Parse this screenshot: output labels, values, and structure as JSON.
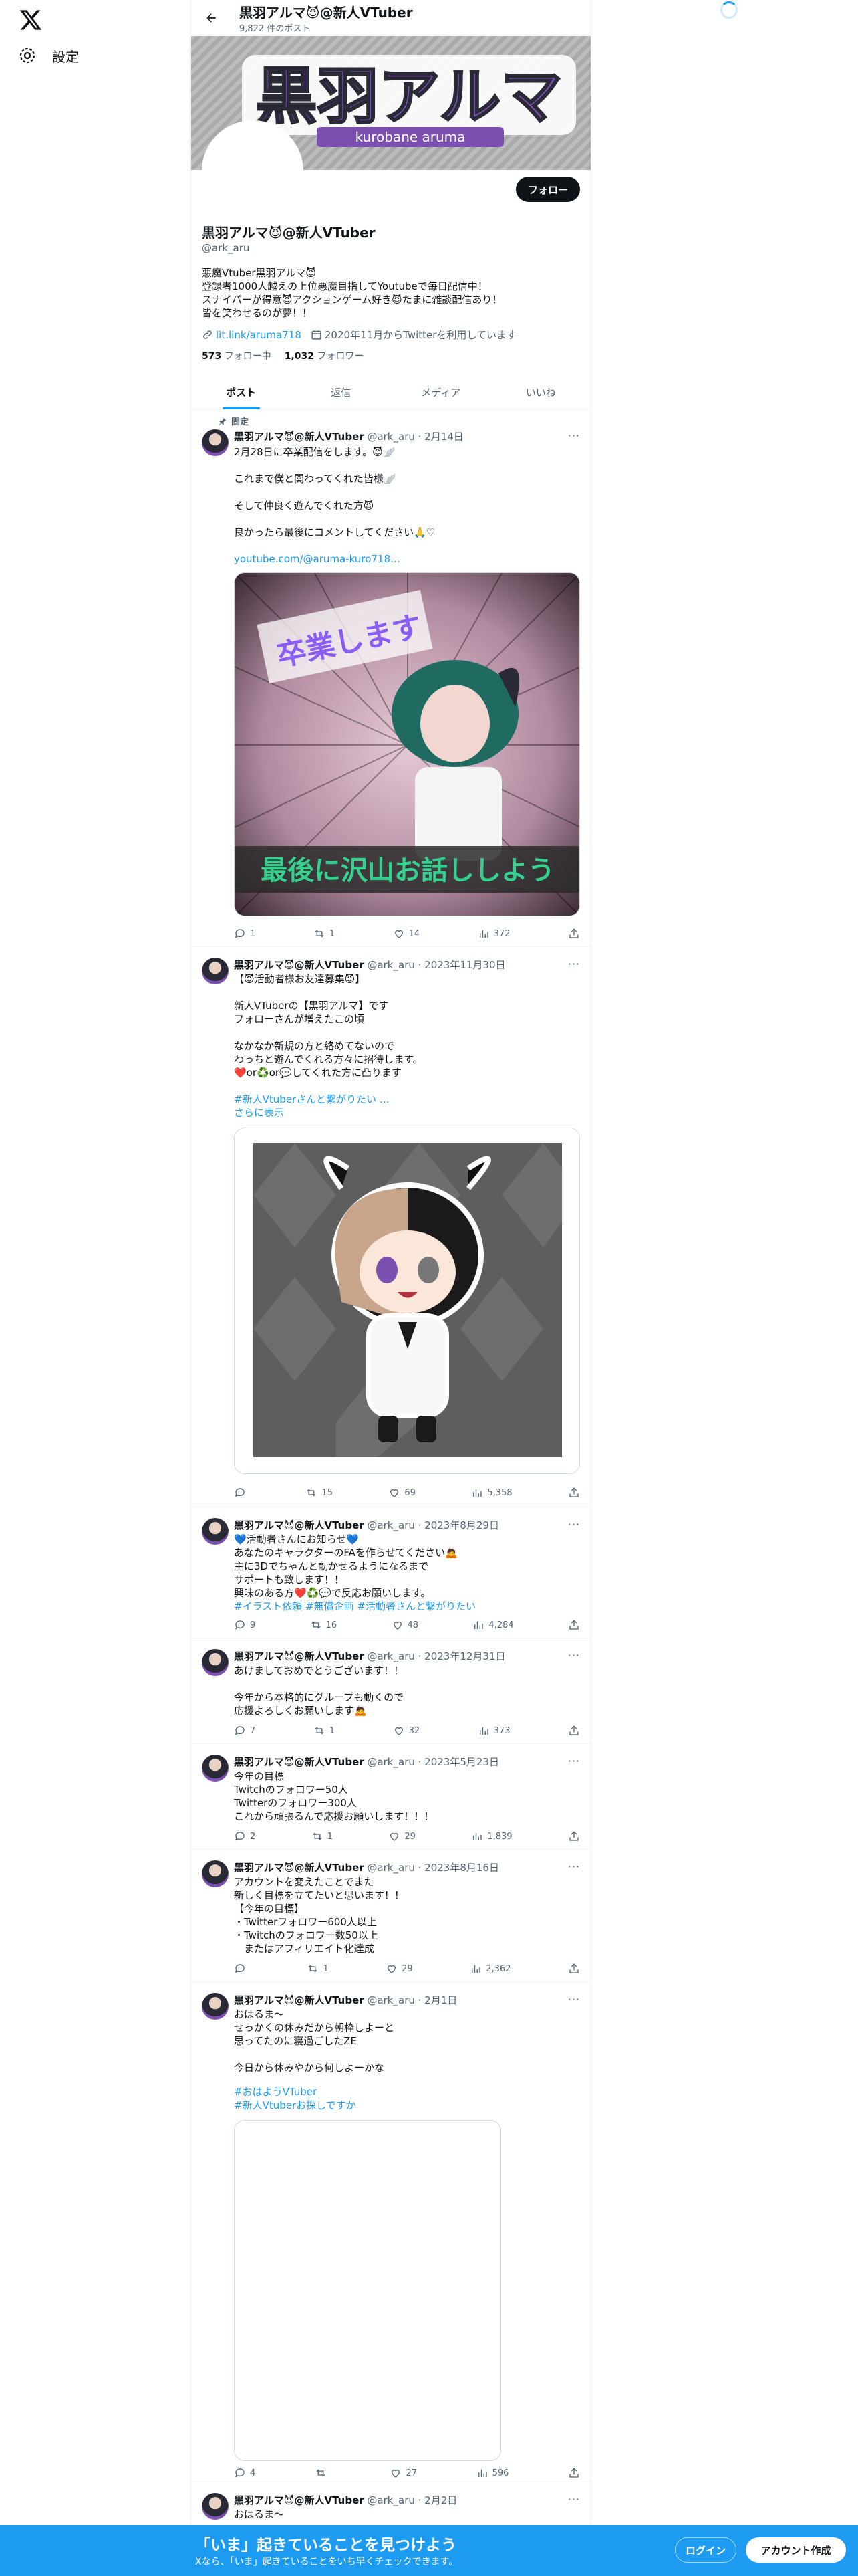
{
  "nav": {
    "settings_label": "設定"
  },
  "header": {
    "name": "黒羽アルマ😈@新人VTuber",
    "post_count": "9,822 件のポスト"
  },
  "banner": {
    "logo_text": "黒羽アルマ",
    "logo_sub": "kurobane aruma",
    "bg_color": "#b2b2b2",
    "accent": "#7a4fb0"
  },
  "profile": {
    "follow_label": "フォロー",
    "name": "黒羽アルマ😈@新人VTuber",
    "handle": "@ark_aru",
    "bio": "悪魔Vtuber黒羽アルマ😈\n登録者1000人越えの上位悪魔目指してYoutubeで毎日配信中！\nスナイパーが得意😈アクションゲーム好き😈たまに雑談配信あり！\n皆を笑わせるのが夢！！",
    "link": "lit.link/aruma718",
    "joined": "2020年11月からTwitterを利用しています",
    "following_count": "573",
    "following_label": "フォロー中",
    "followers_count": "1,032",
    "followers_label": "フォロワー"
  },
  "tabs": [
    "ポスト",
    "返信",
    "メディア",
    "いいね"
  ],
  "pinned_label": "固定",
  "posts": [
    {
      "name": "黒羽アルマ😈@新人VTuber",
      "meta": "@ark_aru · 2月14日",
      "text": "2月28日に卒業配信をします。😈🪽\n\nこれまで僕と関わってくれた皆様🪽\n\nそして仲良く遊んでくれた方😈\n\n良かったら最後にコメントしてください🙏♡",
      "link": "youtube.com/@aruma-kuro718…",
      "media_top_text": "卒業します",
      "media_bottom_text": "最後に沢山お話ししよう",
      "replies": "1",
      "reposts": "1",
      "likes": "14",
      "views": "372"
    },
    {
      "name": "黒羽アルマ😈@新人VTuber",
      "meta": "@ark_aru · 2023年11月30日",
      "text": "【😈活動者様お友達募集😈】\n\n新人VTuberの【黒羽アルマ】です\nフォローさんが増えたこの頃\n\nなかなか新規の方と絡めてないので\nわっちと遊んでくれる方々に招待します。\n❤️or♻️or💬してくれた方に凸ります",
      "hashtags": "#新人Vtuberさんと繋がりたい …",
      "more": "さらに表示",
      "replies": "",
      "reposts": "15",
      "likes": "69",
      "views": "5,358"
    },
    {
      "name": "黒羽アルマ😈@新人VTuber",
      "meta": "@ark_aru · 2023年8月29日",
      "text": "💙活動者さんにお知らせ💙\nあなたのキャラクターのFAを作らせてください🙇\n主に3Dでちゃんと動かせるようになるまで\nサポートも致します！！\n興味のある方❤️♻️💬で反応お願いします。",
      "hashtags": "#イラスト依頼 #無償企画 #活動者さんと繋がりたい",
      "replies": "9",
      "reposts": "16",
      "likes": "48",
      "views": "4,284"
    },
    {
      "name": "黒羽アルマ😈@新人VTuber",
      "meta": "@ark_aru · 2023年12月31日",
      "text": "あけましておめでとうございます！！\n\n今年から本格的にグループも動くので\n応援よろしくお願いします🙇",
      "replies": "7",
      "reposts": "1",
      "likes": "32",
      "views": "373"
    },
    {
      "name": "黒羽アルマ😈@新人VTuber",
      "meta": "@ark_aru · 2023年5月23日",
      "text": "今年の目標\nTwitchのフォロワー50人\nTwitterのフォロワー300人\nこれから頑張るんで応援お願いします！！！",
      "replies": "2",
      "reposts": "1",
      "likes": "29",
      "views": "1,839"
    },
    {
      "name": "黒羽アルマ😈@新人VTuber",
      "meta": "@ark_aru · 2023年8月16日",
      "text": "アカウントを変えたことでまた\n新しく目標を立てたいと思います！！\n【今年の目標】\n・Twitterフォロワー600人以上\n・Twitchのフォロワー数50以上\n　またはアフィリエイト化達成",
      "replies": "",
      "reposts": "1",
      "likes": "29",
      "views": "2,362"
    },
    {
      "name": "黒羽アルマ😈@新人VTuber",
      "meta": "@ark_aru · 2月1日",
      "text": "おはるま～\nせっかくの休みだから朝枠しよーと\n思ってたのに寝過ごしたZE\n\n今日から休みやから何しよーかな",
      "hashtags": "#おはようVTuber\n#新人Vtuberお探しですか",
      "replies": "4",
      "reposts": "",
      "likes": "27",
      "views": "596"
    },
    {
      "name": "黒羽アルマ😈@新人VTuber",
      "meta": "@ark_aru · 2月2日",
      "text": "おはるま～"
    }
  ],
  "bottom_bar": {
    "title": "「いま」起きていることを見つけよう",
    "subtitle": "Xなら、「いま」起きていることをいち早くチェックできます。",
    "login_label": "ログイン",
    "signup_label": "アカウント作成"
  }
}
